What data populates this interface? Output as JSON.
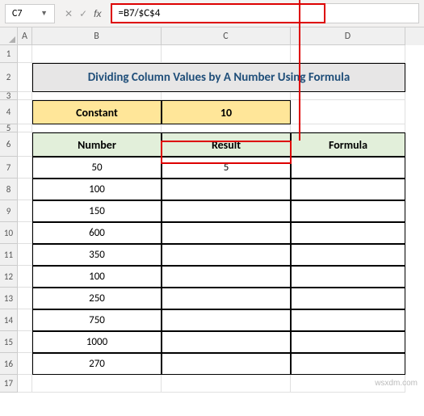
{
  "nameBox": "C7",
  "formulaBar": "=B7/$C$4",
  "columns": [
    "A",
    "B",
    "C",
    "D"
  ],
  "rowNums": [
    "1",
    "2",
    "3",
    "4",
    "5",
    "6",
    "7",
    "8",
    "9",
    "10",
    "11",
    "12",
    "13",
    "14",
    "15",
    "16",
    "17"
  ],
  "title": "Dividing Column Values by A  Number Using Formula",
  "constantLabel": "Constant",
  "constantValue": "10",
  "headers": {
    "number": "Number",
    "result": "Result",
    "formula": "Formula"
  },
  "data": [
    {
      "number": "50",
      "result": "5",
      "formula": ""
    },
    {
      "number": "100",
      "result": "",
      "formula": ""
    },
    {
      "number": "150",
      "result": "",
      "formula": ""
    },
    {
      "number": "600",
      "result": "",
      "formula": ""
    },
    {
      "number": "350",
      "result": "",
      "formula": ""
    },
    {
      "number": "100",
      "result": "",
      "formula": ""
    },
    {
      "number": "250",
      "result": "",
      "formula": ""
    },
    {
      "number": "750",
      "result": "",
      "formula": ""
    },
    {
      "number": "1000",
      "result": "",
      "formula": ""
    },
    {
      "number": "270",
      "result": "",
      "formula": ""
    }
  ],
  "watermark": "wsxdm.com"
}
